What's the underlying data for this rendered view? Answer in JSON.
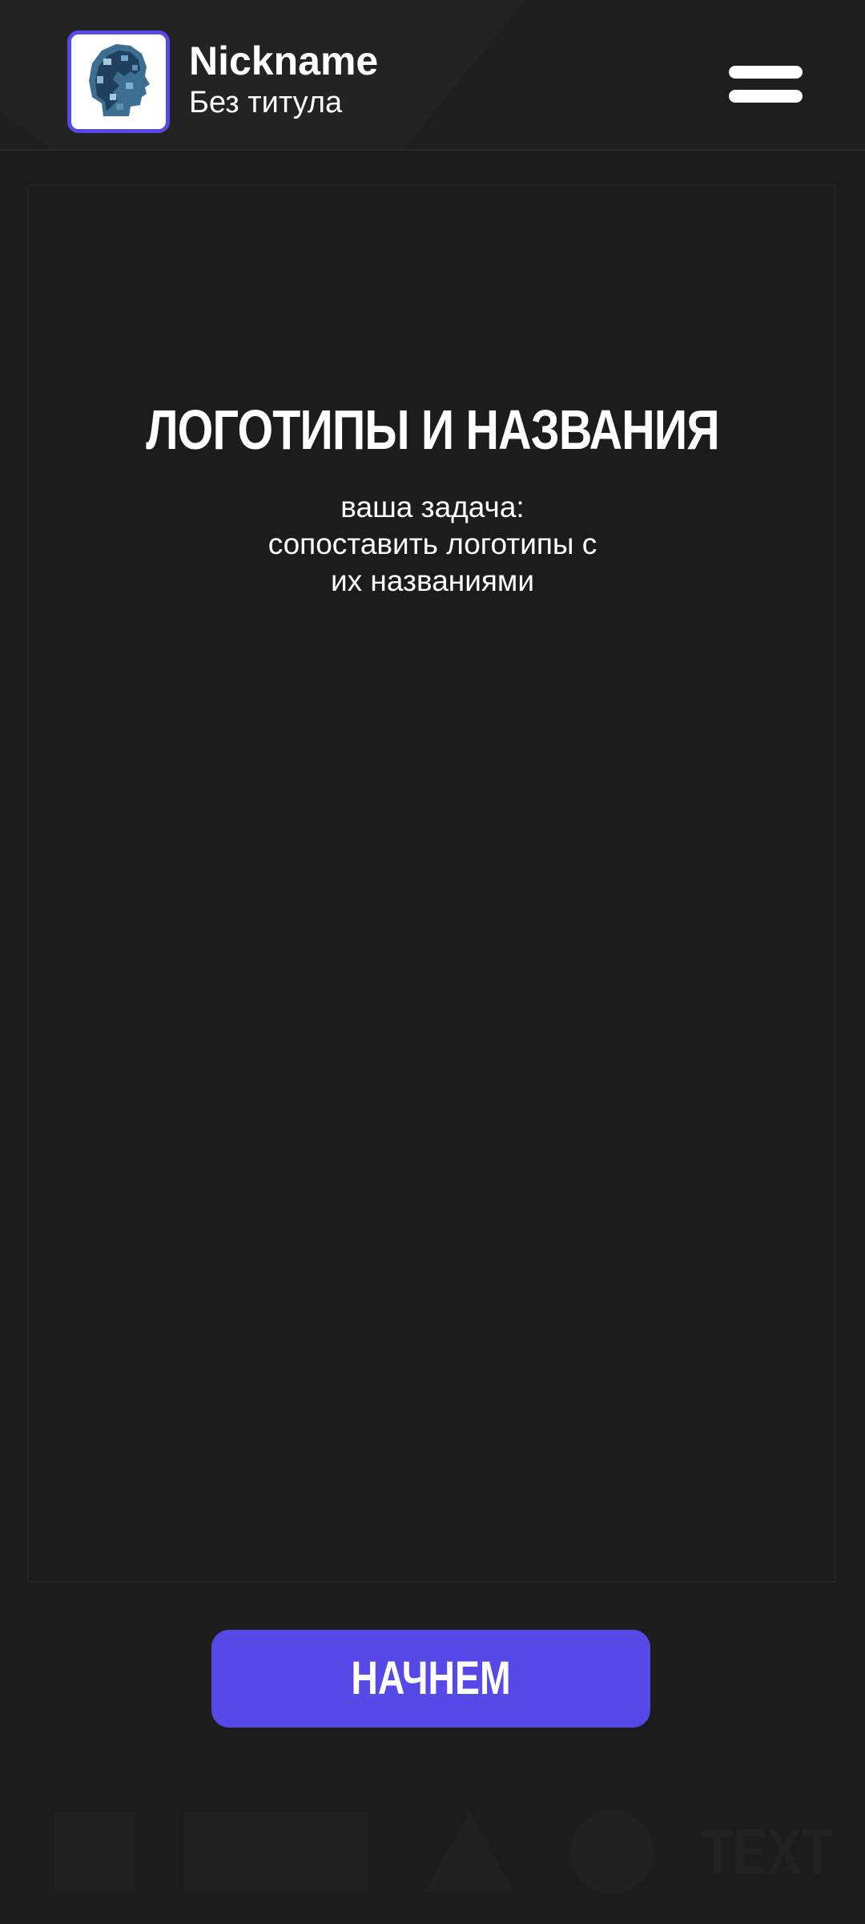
{
  "header": {
    "nickname": "Nickname",
    "user_title": "Без титула",
    "avatar_icon": "head-portrait-icon",
    "menu_icon": "hamburger-menu-icon"
  },
  "main": {
    "title": "ЛОГОТИПЫ И НАЗВАНИЯ",
    "task_lines": [
      "ваша задача:",
      "сопоставить логотипы с",
      "их названиями"
    ]
  },
  "start_button": {
    "label": "НАЧНЕМ"
  },
  "footer": {
    "shapes": [
      "square",
      "rectangle",
      "triangle",
      "circle"
    ],
    "deco_text": "TEXT"
  },
  "colors": {
    "background": "#1c1c1c",
    "header": "#1e1e1e",
    "accent": "#5749e8",
    "text": "#ffffff"
  }
}
